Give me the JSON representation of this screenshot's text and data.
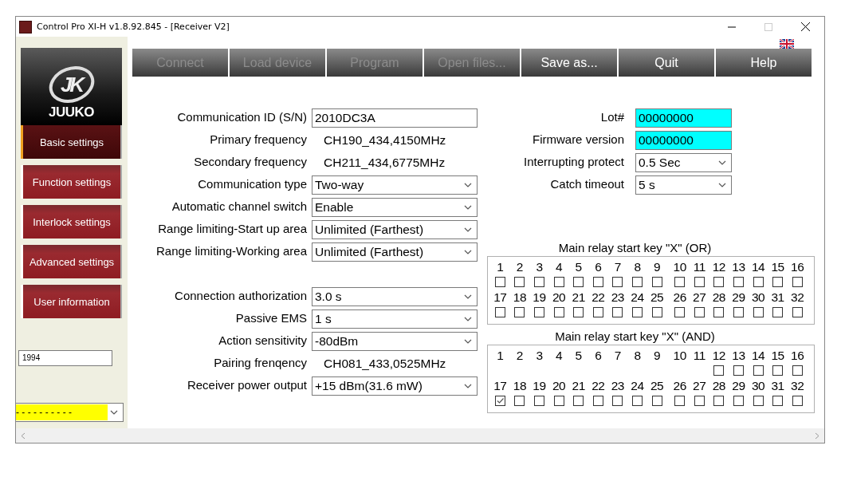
{
  "window": {
    "title": "Control Pro XI-H v1.8.92.845 - [Receiver V2]"
  },
  "sidebar": {
    "logo_mark": "JK",
    "brand": "JUUKO",
    "nav": [
      {
        "label": "Basic settings",
        "selected": true
      },
      {
        "label": "Function settings",
        "selected": false
      },
      {
        "label": "Interlock settings",
        "selected": false
      },
      {
        "label": "Advanced settings",
        "selected": false
      },
      {
        "label": "User information",
        "selected": false
      }
    ],
    "code_field": {
      "value": "1994"
    },
    "combo": {
      "value": "- - - - - - - - - -"
    }
  },
  "toolbar": [
    {
      "label": "Connect",
      "disabled": true
    },
    {
      "label": "Load device",
      "disabled": true
    },
    {
      "label": "Program",
      "disabled": true
    },
    {
      "label": "Open files...",
      "disabled": true
    },
    {
      "label": "Save as...",
      "disabled": false
    },
    {
      "label": "Quit",
      "disabled": false
    },
    {
      "label": "Help",
      "disabled": false
    }
  ],
  "form_left": [
    [
      {
        "label": "Communication ID (S/N)",
        "kind": "input",
        "value": "2010DC3A"
      },
      {
        "label": "Primary frequency",
        "kind": "text",
        "value": "CH190_434,4150MHz"
      },
      {
        "label": "Secondary frequency",
        "kind": "text",
        "value": "CH211_434,6775MHz"
      },
      {
        "label": "Communication type",
        "kind": "select",
        "value": "Two-way"
      },
      {
        "label": "Automatic channel switch",
        "kind": "select",
        "value": "Enable"
      },
      {
        "label": "Range limiting-Start up area",
        "kind": "select",
        "value": "Unlimited (Farthest)"
      },
      {
        "label": "Range limiting-Working area",
        "kind": "select",
        "value": "Unlimited (Farthest)"
      }
    ],
    [
      {
        "label": "Connection authorization",
        "kind": "select",
        "value": "3.0 s"
      },
      {
        "label": "Passive EMS",
        "kind": "select",
        "value": "1 s"
      },
      {
        "label": "Action sensitivity",
        "kind": "select",
        "value": "-80dBm"
      },
      {
        "label": "Pairing frenqency",
        "kind": "text",
        "value": "CH081_433,0525MHz"
      },
      {
        "label": "Receiver power output",
        "kind": "select",
        "value": "+15 dBm(31.6 mW)"
      }
    ]
  ],
  "form_right": [
    {
      "label": "Lot#",
      "kind": "highlighted_input",
      "value": "00000000"
    },
    {
      "label": "Firmware version",
      "kind": "highlighted_input",
      "value": "00000000"
    },
    {
      "label": "Interrupting protect",
      "kind": "select",
      "value": "0.5 Sec"
    },
    {
      "label": "Catch timeout",
      "kind": "select",
      "value": "5 s"
    }
  ],
  "relay_groups": [
    {
      "title": "Main relay start key \"X\" (OR)",
      "keys": [
        {
          "label": "1",
          "kind": "checkbox",
          "checked": false
        },
        {
          "label": "2",
          "kind": "checkbox",
          "checked": false
        },
        {
          "label": "3",
          "kind": "checkbox",
          "checked": false
        },
        {
          "label": "4",
          "kind": "checkbox",
          "checked": false
        },
        {
          "label": "5",
          "kind": "checkbox",
          "checked": false
        },
        {
          "label": "6",
          "kind": "checkbox",
          "checked": false
        },
        {
          "label": "7",
          "kind": "checkbox",
          "checked": false
        },
        {
          "label": "8",
          "kind": "checkbox",
          "checked": false
        },
        {
          "label": "9",
          "kind": "checkbox",
          "checked": false
        },
        {
          "label": "10",
          "kind": "checkbox",
          "checked": false
        },
        {
          "label": "11",
          "kind": "checkbox",
          "checked": false
        },
        {
          "label": "12",
          "kind": "checkbox",
          "checked": false
        },
        {
          "label": "13",
          "kind": "checkbox",
          "checked": false
        },
        {
          "label": "14",
          "kind": "checkbox",
          "checked": false
        },
        {
          "label": "15",
          "kind": "checkbox",
          "checked": false
        },
        {
          "label": "16",
          "kind": "checkbox",
          "checked": false
        },
        {
          "label": "17",
          "kind": "checkbox",
          "checked": false
        },
        {
          "label": "18",
          "kind": "checkbox",
          "checked": false
        },
        {
          "label": "19",
          "kind": "checkbox",
          "checked": false
        },
        {
          "label": "20",
          "kind": "checkbox",
          "checked": false
        },
        {
          "label": "21",
          "kind": "checkbox",
          "checked": false
        },
        {
          "label": "22",
          "kind": "checkbox",
          "checked": false
        },
        {
          "label": "23",
          "kind": "checkbox",
          "checked": false
        },
        {
          "label": "24",
          "kind": "checkbox",
          "checked": false
        },
        {
          "label": "25",
          "kind": "checkbox",
          "checked": false
        },
        {
          "label": "26",
          "kind": "checkbox",
          "checked": false
        },
        {
          "label": "27",
          "kind": "checkbox",
          "checked": false
        },
        {
          "label": "28",
          "kind": "checkbox",
          "checked": false
        },
        {
          "label": "29",
          "kind": "checkbox",
          "checked": false
        },
        {
          "label": "30",
          "kind": "checkbox",
          "checked": false
        },
        {
          "label": "31",
          "kind": "checkbox",
          "checked": false
        },
        {
          "label": "32",
          "kind": "checkbox",
          "checked": false
        }
      ]
    },
    {
      "title": "Main relay start key \"X\" (AND)",
      "keys": [
        {
          "label": "1",
          "kind": "plain"
        },
        {
          "label": "2",
          "kind": "plain"
        },
        {
          "label": "3",
          "kind": "plain"
        },
        {
          "label": "4",
          "kind": "plain"
        },
        {
          "label": "5",
          "kind": "plain"
        },
        {
          "label": "6",
          "kind": "plain"
        },
        {
          "label": "7",
          "kind": "plain"
        },
        {
          "label": "8",
          "kind": "plain"
        },
        {
          "label": "9",
          "kind": "plain"
        },
        {
          "label": "10",
          "kind": "plain"
        },
        {
          "label": "11",
          "kind": "plain"
        },
        {
          "label": "12",
          "kind": "checkbox",
          "checked": false
        },
        {
          "label": "13",
          "kind": "checkbox",
          "checked": false
        },
        {
          "label": "14",
          "kind": "checkbox",
          "checked": false
        },
        {
          "label": "15",
          "kind": "checkbox",
          "checked": false
        },
        {
          "label": "16",
          "kind": "checkbox",
          "checked": false
        },
        {
          "label": "17",
          "kind": "checkbox",
          "checked": true
        },
        {
          "label": "18",
          "kind": "checkbox",
          "checked": false
        },
        {
          "label": "19",
          "kind": "checkbox",
          "checked": false
        },
        {
          "label": "20",
          "kind": "checkbox",
          "checked": false
        },
        {
          "label": "21",
          "kind": "checkbox",
          "checked": false
        },
        {
          "label": "22",
          "kind": "checkbox",
          "checked": false
        },
        {
          "label": "23",
          "kind": "checkbox",
          "checked": false
        },
        {
          "label": "24",
          "kind": "checkbox",
          "checked": false
        },
        {
          "label": "25",
          "kind": "checkbox",
          "checked": false
        },
        {
          "label": "26",
          "kind": "checkbox",
          "checked": false
        },
        {
          "label": "27",
          "kind": "checkbox",
          "checked": false
        },
        {
          "label": "28",
          "kind": "checkbox",
          "checked": false
        },
        {
          "label": "29",
          "kind": "checkbox",
          "checked": false
        },
        {
          "label": "30",
          "kind": "checkbox",
          "checked": false
        },
        {
          "label": "31",
          "kind": "checkbox",
          "checked": false
        },
        {
          "label": "32",
          "kind": "checkbox",
          "checked": false
        }
      ]
    }
  ]
}
